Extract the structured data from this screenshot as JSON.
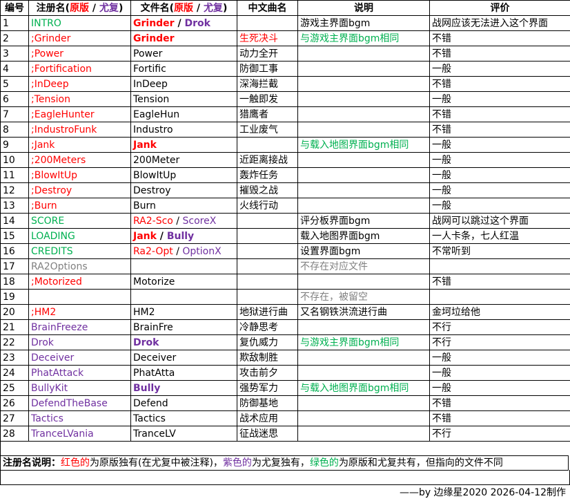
{
  "headers": {
    "num": "编号",
    "reg_prefix": "注册名(",
    "reg_orig": "原版",
    "reg_sep": " / ",
    "reg_yr": "尤复",
    "reg_suffix": ")",
    "file_prefix": "文件名(",
    "file_orig": "原版",
    "file_sep": " / ",
    "file_yr": "尤复",
    "file_suffix": ")",
    "cn": "中文曲名",
    "desc": "说明",
    "eval": "评价"
  },
  "colors": {
    "red": "#ff0000",
    "purple": "#7030a0",
    "green": "#00b050",
    "gray": "#808080"
  },
  "rows": [
    {
      "num": "1",
      "reg": "INTRO",
      "reg_color": "green",
      "file": [
        {
          "t": "Grinder",
          "c": "red",
          "b": true
        },
        {
          "t": " / ",
          "c": "",
          "b": true
        },
        {
          "t": "Drok",
          "c": "purple",
          "b": true
        }
      ],
      "cn": "",
      "cn_color": "",
      "desc": "游戏主界面bgm",
      "desc_color": "",
      "eval": "战网应该无法进入这个界面"
    },
    {
      "num": "2",
      "reg": ";Grinder",
      "reg_color": "red",
      "file": [
        {
          "t": "Grinder",
          "c": "red",
          "b": true
        }
      ],
      "cn": "生死决斗",
      "cn_color": "red",
      "desc": "与游戏主界面bgm相同",
      "desc_color": "green",
      "eval": "不错"
    },
    {
      "num": "3",
      "reg": ";Power",
      "reg_color": "red",
      "file": [
        {
          "t": "Power",
          "c": "",
          "b": false
        }
      ],
      "cn": "动力全开",
      "cn_color": "",
      "desc": "",
      "desc_color": "",
      "eval": "不错"
    },
    {
      "num": "4",
      "reg": ";Fortification",
      "reg_color": "red",
      "file": [
        {
          "t": "Fortific",
          "c": "",
          "b": false
        }
      ],
      "cn": "防御工事",
      "cn_color": "",
      "desc": "",
      "desc_color": "",
      "eval": "一般"
    },
    {
      "num": "5",
      "reg": ";InDeep",
      "reg_color": "red",
      "file": [
        {
          "t": "InDeep",
          "c": "",
          "b": false
        }
      ],
      "cn": "深海拦截",
      "cn_color": "",
      "desc": "",
      "desc_color": "",
      "eval": "不错"
    },
    {
      "num": "6",
      "reg": ";Tension",
      "reg_color": "red",
      "file": [
        {
          "t": "Tension",
          "c": "",
          "b": false
        }
      ],
      "cn": "一触即发",
      "cn_color": "",
      "desc": "",
      "desc_color": "",
      "eval": "一般"
    },
    {
      "num": "7",
      "reg": ";EagleHunter",
      "reg_color": "red",
      "file": [
        {
          "t": "EagleHun",
          "c": "",
          "b": false
        }
      ],
      "cn": "猎鹰者",
      "cn_color": "",
      "desc": "",
      "desc_color": "",
      "eval": "不错"
    },
    {
      "num": "8",
      "reg": ";IndustroFunk",
      "reg_color": "red",
      "file": [
        {
          "t": "Industro",
          "c": "",
          "b": false
        }
      ],
      "cn": "工业废气",
      "cn_color": "",
      "desc": "",
      "desc_color": "",
      "eval": "不错"
    },
    {
      "num": "9",
      "reg": ";Jank",
      "reg_color": "red",
      "file": [
        {
          "t": "Jank",
          "c": "red",
          "b": true
        }
      ],
      "cn": "",
      "cn_color": "",
      "desc": "与载入地图界面bgm相同",
      "desc_color": "green",
      "eval": "一般"
    },
    {
      "num": "10",
      "reg": ";200Meters",
      "reg_color": "red",
      "file": [
        {
          "t": "200Meter",
          "c": "",
          "b": false
        }
      ],
      "cn": "近距离接战",
      "cn_color": "",
      "desc": "",
      "desc_color": "",
      "eval": "一般"
    },
    {
      "num": "11",
      "reg": ";BlowItUp",
      "reg_color": "red",
      "file": [
        {
          "t": "BlowItUp",
          "c": "",
          "b": false
        }
      ],
      "cn": "轰炸任务",
      "cn_color": "",
      "desc": "",
      "desc_color": "",
      "eval": "一般"
    },
    {
      "num": "12",
      "reg": ";Destroy",
      "reg_color": "red",
      "file": [
        {
          "t": "Destroy",
          "c": "",
          "b": false
        }
      ],
      "cn": "摧毁之战",
      "cn_color": "",
      "desc": "",
      "desc_color": "",
      "eval": "一般"
    },
    {
      "num": "13",
      "reg": ";Burn",
      "reg_color": "red",
      "file": [
        {
          "t": "Burn",
          "c": "",
          "b": false
        }
      ],
      "cn": "火线行动",
      "cn_color": "",
      "desc": "",
      "desc_color": "",
      "eval": "一般"
    },
    {
      "num": "14",
      "reg": "SCORE",
      "reg_color": "green",
      "file": [
        {
          "t": "RA2-Sco",
          "c": "red",
          "b": false
        },
        {
          "t": " / ",
          "c": "",
          "b": false
        },
        {
          "t": "ScoreX",
          "c": "purple",
          "b": false
        }
      ],
      "cn": "",
      "cn_color": "",
      "desc": "评分板界面bgm",
      "desc_color": "",
      "eval": "战网可以跳过这个界面"
    },
    {
      "num": "15",
      "reg": "LOADING",
      "reg_color": "green",
      "file": [
        {
          "t": "Jank",
          "c": "red",
          "b": true
        },
        {
          "t": " / ",
          "c": "",
          "b": true
        },
        {
          "t": "Bully",
          "c": "purple",
          "b": true
        }
      ],
      "cn": "",
      "cn_color": "",
      "desc": "载入地图界面bgm",
      "desc_color": "",
      "eval": "一人卡条，七人红温"
    },
    {
      "num": "16",
      "reg": "CREDITS",
      "reg_color": "green",
      "file": [
        {
          "t": "Ra2-Opt",
          "c": "red",
          "b": false
        },
        {
          "t": " / ",
          "c": "",
          "b": false
        },
        {
          "t": "OptionX",
          "c": "purple",
          "b": false
        }
      ],
      "cn": "",
      "cn_color": "",
      "desc": "设置界面bgm",
      "desc_color": "",
      "eval": "不常听到"
    },
    {
      "num": "17",
      "reg": "RA2Options",
      "reg_color": "gray",
      "file": [],
      "cn": "",
      "cn_color": "",
      "desc": "不存在对应文件",
      "desc_color": "gray",
      "eval": ""
    },
    {
      "num": "18",
      "reg": ";Motorized",
      "reg_color": "red",
      "file": [
        {
          "t": "Motorize",
          "c": "",
          "b": false
        }
      ],
      "cn": "",
      "cn_color": "",
      "desc": "",
      "desc_color": "",
      "eval": "不错"
    },
    {
      "num": "19",
      "reg": "",
      "reg_color": "",
      "file": [],
      "cn": "",
      "cn_color": "",
      "desc": "不存在，被留空",
      "desc_color": "gray",
      "eval": ""
    },
    {
      "num": "20",
      "reg": ";HM2",
      "reg_color": "red",
      "file": [
        {
          "t": "HM2",
          "c": "",
          "b": false
        }
      ],
      "cn": "地狱进行曲",
      "cn_color": "",
      "desc": "又名钢铁洪流进行曲",
      "desc_color": "",
      "eval": "金坷垃给他"
    },
    {
      "num": "21",
      "reg": "BrainFreeze",
      "reg_color": "purple",
      "file": [
        {
          "t": "BrainFre",
          "c": "",
          "b": false
        }
      ],
      "cn": "冷静思考",
      "cn_color": "",
      "desc": "",
      "desc_color": "",
      "eval": "不行"
    },
    {
      "num": "22",
      "reg": "Drok",
      "reg_color": "purple",
      "file": [
        {
          "t": "Drok",
          "c": "purple",
          "b": true
        }
      ],
      "cn": "复仇威力",
      "cn_color": "",
      "desc": "与游戏主界面bgm相同",
      "desc_color": "green",
      "eval": "不行"
    },
    {
      "num": "23",
      "reg": "Deceiver",
      "reg_color": "purple",
      "file": [
        {
          "t": "Deceiver",
          "c": "",
          "b": false
        }
      ],
      "cn": "欺敌制胜",
      "cn_color": "",
      "desc": "",
      "desc_color": "",
      "eval": "一般"
    },
    {
      "num": "24",
      "reg": "PhatAttack",
      "reg_color": "purple",
      "file": [
        {
          "t": "PhatAtta",
          "c": "",
          "b": false
        }
      ],
      "cn": "攻击前夕",
      "cn_color": "",
      "desc": "",
      "desc_color": "",
      "eval": "一般"
    },
    {
      "num": "25",
      "reg": "BullyKit",
      "reg_color": "purple",
      "file": [
        {
          "t": "Bully",
          "c": "purple",
          "b": true
        }
      ],
      "cn": "强势军力",
      "cn_color": "",
      "desc": "与载入地图界面bgm相同",
      "desc_color": "green",
      "eval": "一般"
    },
    {
      "num": "26",
      "reg": "DefendTheBase",
      "reg_color": "purple",
      "file": [
        {
          "t": "Defend",
          "c": "",
          "b": false
        }
      ],
      "cn": "防御基地",
      "cn_color": "",
      "desc": "",
      "desc_color": "",
      "eval": "不错"
    },
    {
      "num": "27",
      "reg": "Tactics",
      "reg_color": "purple",
      "file": [
        {
          "t": "Tactics",
          "c": "",
          "b": false
        }
      ],
      "cn": "战术应用",
      "cn_color": "",
      "desc": "",
      "desc_color": "",
      "eval": "不错"
    },
    {
      "num": "28",
      "reg": "TranceLVania",
      "reg_color": "purple",
      "file": [
        {
          "t": "TranceLV",
          "c": "",
          "b": false
        }
      ],
      "cn": "征战迷思",
      "cn_color": "",
      "desc": "",
      "desc_color": "",
      "eval": "不行"
    }
  ],
  "note": {
    "label": "注册名说明：",
    "red_text": "红色的",
    "red_rest": "为原版独有(在尤复中被注释)，",
    "purple_text": "紫色的",
    "purple_rest": "为尤复独有，",
    "green_text": "绿色的",
    "green_rest": "为原版和尤复共有，但指向的文件不同"
  },
  "credit": "——by 边缘星2020 2026-04-12制作"
}
